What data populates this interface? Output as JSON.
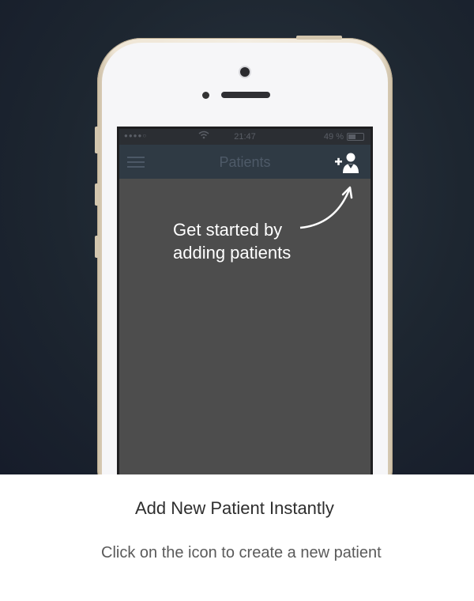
{
  "status_bar": {
    "signal": "●●●●○",
    "wifi_icon": "wifi-icon",
    "time": "21:47",
    "battery_percent": "49 %",
    "battery_icon": "battery-icon"
  },
  "navbar": {
    "menu_icon": "hamburger-menu-icon",
    "title": "Patients",
    "add_icon": "add-patient-icon"
  },
  "hint": {
    "line1": "Get started by",
    "line2": "adding patients"
  },
  "caption": {
    "title": "Add New Patient Instantly",
    "subtitle": "Click on the icon to create a new patient"
  },
  "colors": {
    "navbar_bg": "#2f3a44",
    "content_bg": "#4d4d4d",
    "hint_text": "#ffffff",
    "phone_gold": "#efe6d6"
  }
}
